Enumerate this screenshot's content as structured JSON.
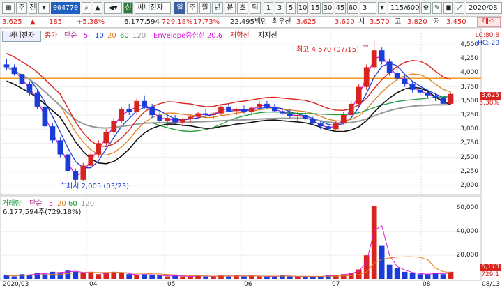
{
  "toolbar": {
    "icon_left": "grid-icon",
    "market_type": "주",
    "menu": "전",
    "code": "004770",
    "search_icon": "magnifier-icon",
    "step": "▲",
    "speaker_icon": "speaker-icon",
    "credit_badge": "신",
    "stock_name": "써니전자",
    "periods": [
      "일",
      "주",
      "월",
      "년",
      "분",
      "초",
      "틱"
    ],
    "active_period": "일",
    "intervals": [
      "1",
      "3",
      "5",
      "10",
      "15",
      "30",
      "45",
      "60"
    ],
    "multiplier": "3",
    "page_counter": "115/600",
    "date": "2020/08"
  },
  "infobar": {
    "price": "3,625",
    "change_arrow": "▲",
    "change": "185",
    "change_pct": "+5.38%",
    "volume": "6,177,594",
    "turnover": "729.18%",
    "rotation": "17.73%",
    "amount": "22,495백만",
    "best_bid_label": "최우선",
    "best_ask": "3,625",
    "best_bid": "3,620",
    "open_label": "시",
    "open": "3,570",
    "high_label": "고",
    "high": "3,820",
    "low_label": "저",
    "low": "3,450",
    "action_button": "매수"
  },
  "legend": {
    "stock_label": "써니전자",
    "price_label": "종가",
    "ma_label": "단순",
    "ma_periods": [
      "5",
      "10",
      "20",
      "60",
      "120"
    ],
    "ma_colors": [
      "#d81bd8",
      "#1a3cd8",
      "#e08020",
      "#1a9a3a",
      "#999999"
    ],
    "envelope": "Envelope중심선 20,6",
    "resistance": "저항선",
    "support": "지지선",
    "volume_label": "거래량",
    "volume_ma_label": "단순",
    "volume_value": "6,177,594주(729.18%)"
  },
  "annotations": {
    "high_note": "최고 4,570 (07/15)",
    "low_note": "최저 2,005 (03/23)"
  },
  "right_tags": {
    "lc": "LC:80.8",
    "hc": "HC:-20",
    "last": "3,625",
    "change": "5.38%",
    "volume_last": "6,178",
    "volume_pct": "729.1"
  },
  "axis": {
    "price_ticks": [
      "4,500",
      "4,250",
      "4,000",
      "3,750",
      "3,500",
      "3,250",
      "3,000",
      "2,750",
      "2,500",
      "2,250",
      "2,000"
    ],
    "volume_ticks": [
      "60,000",
      "40,000",
      "20,000"
    ],
    "x_labels": [
      "2020/03",
      "04",
      "05",
      "06",
      "07",
      "08",
      "08/13"
    ]
  },
  "chart_data": {
    "type": "candlestick",
    "resistance_line": 3900,
    "ylim": [
      1850,
      4700
    ],
    "candles": [
      [
        4150,
        4250,
        4050,
        4100
      ],
      [
        4100,
        4150,
        3950,
        3980
      ],
      [
        3980,
        4000,
        3750,
        3800
      ],
      [
        3800,
        3850,
        3600,
        3650
      ],
      [
        3650,
        3700,
        3350,
        3400
      ],
      [
        3400,
        3450,
        3000,
        3050
      ],
      [
        3050,
        3100,
        2750,
        2800
      ],
      [
        2800,
        2850,
        2500,
        2550
      ],
      [
        2550,
        2600,
        2200,
        2250
      ],
      [
        2250,
        2300,
        2005,
        2100
      ],
      [
        2100,
        2400,
        2080,
        2350
      ],
      [
        2350,
        2600,
        2300,
        2550
      ],
      [
        2550,
        2800,
        2500,
        2750
      ],
      [
        2750,
        3000,
        2700,
        2950
      ],
      [
        2950,
        3200,
        2900,
        3150
      ],
      [
        3150,
        3400,
        3100,
        3350
      ],
      [
        3350,
        3450,
        3250,
        3300
      ],
      [
        3300,
        3550,
        3250,
        3500
      ],
      [
        3500,
        3600,
        3350,
        3400
      ],
      [
        3400,
        3450,
        3200,
        3250
      ],
      [
        3250,
        3300,
        3100,
        3150
      ],
      [
        3150,
        3250,
        3050,
        3200
      ],
      [
        3200,
        3250,
        3100,
        3120
      ],
      [
        3120,
        3200,
        3050,
        3180
      ],
      [
        3180,
        3250,
        3120,
        3220
      ],
      [
        3220,
        3300,
        3180,
        3280
      ],
      [
        3280,
        3350,
        3200,
        3250
      ],
      [
        3250,
        3300,
        3180,
        3280
      ],
      [
        3280,
        3420,
        3250,
        3400
      ],
      [
        3400,
        3450,
        3300,
        3320
      ],
      [
        3320,
        3380,
        3250,
        3350
      ],
      [
        3350,
        3420,
        3280,
        3300
      ],
      [
        3300,
        3400,
        3250,
        3380
      ],
      [
        3380,
        3500,
        3350,
        3450
      ],
      [
        3450,
        3500,
        3350,
        3400
      ],
      [
        3400,
        3450,
        3300,
        3320
      ],
      [
        3320,
        3380,
        3250,
        3280
      ],
      [
        3280,
        3350,
        3200,
        3230
      ],
      [
        3230,
        3300,
        3150,
        3250
      ],
      [
        3250,
        3300,
        3150,
        3180
      ],
      [
        3180,
        3220,
        3080,
        3100
      ],
      [
        3100,
        3150,
        3000,
        3050
      ],
      [
        3050,
        3100,
        2980,
        3000
      ],
      [
        3000,
        3150,
        2980,
        3100
      ],
      [
        3100,
        3300,
        3080,
        3250
      ],
      [
        3250,
        3500,
        3200,
        3450
      ],
      [
        3450,
        3800,
        3400,
        3750
      ],
      [
        3750,
        4150,
        3700,
        4100
      ],
      [
        4100,
        4570,
        4050,
        4400
      ],
      [
        4400,
        4450,
        4150,
        4200
      ],
      [
        4200,
        4250,
        3950,
        4000
      ],
      [
        4000,
        4100,
        3850,
        3900
      ],
      [
        3900,
        3950,
        3750,
        3800
      ],
      [
        3800,
        3850,
        3650,
        3700
      ],
      [
        3700,
        3750,
        3600,
        3650
      ],
      [
        3650,
        3700,
        3550,
        3600
      ],
      [
        3600,
        3650,
        3500,
        3550
      ],
      [
        3550,
        3600,
        3440,
        3450
      ],
      [
        3450,
        3650,
        3440,
        3625
      ]
    ],
    "volume": [
      3,
      2,
      4,
      3,
      5,
      4,
      6,
      5,
      7,
      6,
      5,
      6,
      4,
      5,
      6,
      5,
      4,
      3,
      4,
      3,
      3,
      2,
      3,
      2,
      2,
      3,
      2,
      2,
      3,
      2,
      3,
      2,
      3,
      2,
      2,
      2,
      3,
      2,
      2,
      2,
      2,
      2,
      3,
      3,
      4,
      5,
      8,
      20,
      62,
      28,
      12,
      9,
      6,
      5,
      4,
      4,
      5,
      4,
      6
    ],
    "volume_ylim": [
      0,
      65000
    ]
  }
}
